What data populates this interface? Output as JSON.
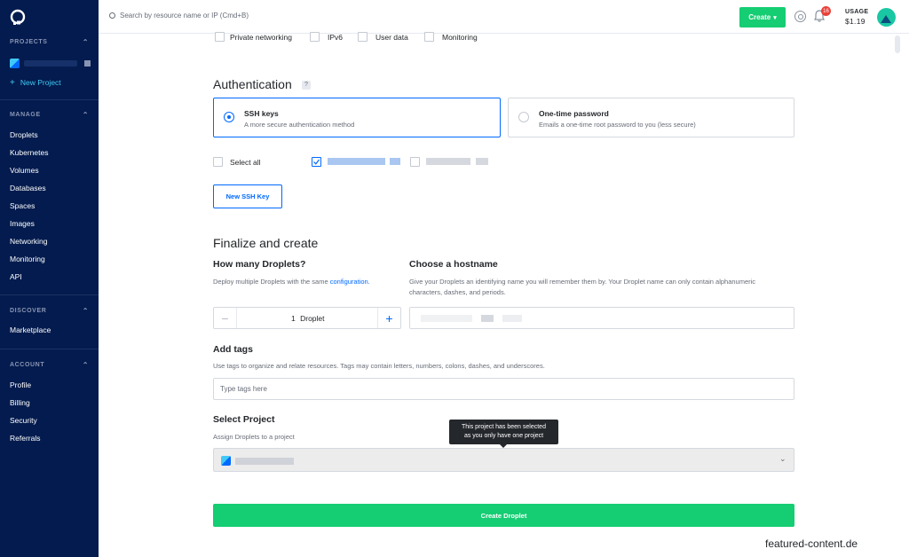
{
  "sidebar": {
    "projects_heading": "PROJECTS",
    "new_project": "New Project",
    "manage_heading": "MANAGE",
    "manage_items": [
      "Droplets",
      "Kubernetes",
      "Volumes",
      "Databases",
      "Spaces",
      "Images",
      "Networking",
      "Monitoring",
      "API"
    ],
    "discover_heading": "DISCOVER",
    "discover_items": [
      "Marketplace"
    ],
    "account_heading": "ACCOUNT",
    "account_items": [
      "Profile",
      "Billing",
      "Security",
      "Referrals"
    ]
  },
  "topbar": {
    "search_placeholder": "Search by resource name or IP (Cmd+B)",
    "create_label": "Create",
    "notification_count": "16",
    "usage_label": "USAGE",
    "usage_amount": "$1.19"
  },
  "options": {
    "private_networking": "Private networking",
    "ipv6": "IPv6",
    "user_data": "User data",
    "monitoring": "Monitoring"
  },
  "authentication": {
    "title": "Authentication",
    "info": "?",
    "ssh_title": "SSH keys",
    "ssh_desc": "A more secure authentication method",
    "otp_title": "One-time password",
    "otp_desc": "Emails a one-time root password to you (less secure)",
    "select_all": "Select all",
    "new_ssh_key": "New SSH Key"
  },
  "finalize": {
    "title": "Finalize and create",
    "count_title": "How many Droplets?",
    "count_help": "Deploy multiple Droplets with the same",
    "count_help_link": "configuration.",
    "count_value": "1",
    "count_unit": "Droplet",
    "hostname_title": "Choose a hostname",
    "hostname_help": "Give your Droplets an identifying name you will remember them by. Your Droplet name can only contain alphanumeric characters, dashes, and periods.",
    "tags_title": "Add tags",
    "tags_help": "Use tags to organize and relate resources. Tags may contain letters, numbers, colons, dashes, and underscores.",
    "tags_placeholder": "Type tags here",
    "project_title": "Select Project",
    "project_help": "Assign Droplets to a project",
    "tooltip_line1": "This project has been selected",
    "tooltip_line2": "as you only have one project",
    "create_button": "Create Droplet"
  },
  "watermark": "featured-content.de",
  "colors": {
    "sidebar_bg": "#031b4e",
    "accent_blue": "#0069ff",
    "create_green": "#15cd72",
    "badge_red": "#e9413a"
  }
}
